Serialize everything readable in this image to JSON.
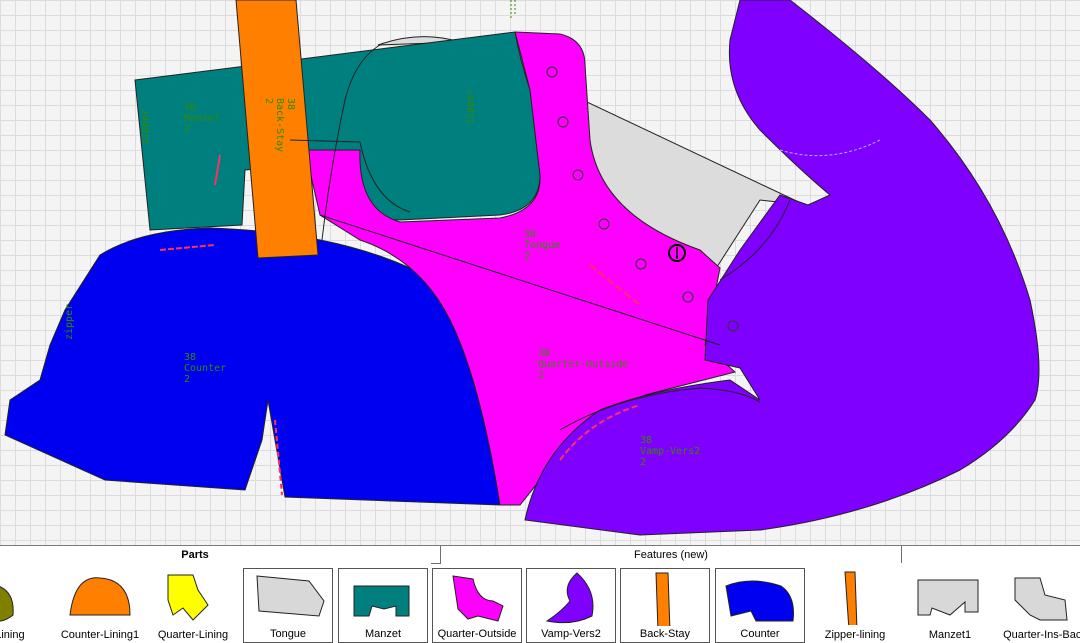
{
  "pieces": {
    "manzet": {
      "size": "38",
      "name": "Manzet",
      "qty": "2"
    },
    "back_stay": {
      "size": "38",
      "name": "Back-Stay",
      "qty": "2"
    },
    "tongue": {
      "size": "38",
      "name": "Tongue",
      "qty": "2"
    },
    "counter": {
      "size": "38",
      "name": "Counter",
      "qty": "2"
    },
    "quarter_outside": {
      "size": "38",
      "name": "Quarter-Outside",
      "qty": "2"
    },
    "vamp": {
      "size": "38",
      "name": "Vamp-Vers2",
      "qty": "2"
    },
    "zipper_label": "zipper"
  },
  "colors": {
    "manzet": "#007f7f",
    "back_stay": "#ff8000",
    "counter": "#0000f0",
    "quarter_outside": "#ff00ff",
    "vamp": "#8000ff",
    "tongue": "#dcdcdc",
    "label": "#2e8b00"
  },
  "panel": {
    "tab_parts": "Parts",
    "tab_features": "Features (new)"
  },
  "thumbnails": [
    {
      "label": "p-Lining",
      "icon": "lining-piece-icon",
      "color": "#808000"
    },
    {
      "label": "Counter-Lining1",
      "icon": "counter-lining-icon",
      "color": "#ff8000"
    },
    {
      "label": "Quarter-Lining",
      "icon": "quarter-lining-icon",
      "color": "#ffff00"
    },
    {
      "label": "Tongue",
      "icon": "tongue-icon",
      "color": "#d8d8d8"
    },
    {
      "label": "Manzet",
      "icon": "manzet-icon",
      "color": "#007f7f"
    },
    {
      "label": "Quarter-Outside",
      "icon": "quarter-outside-icon",
      "color": "#ff00ff"
    },
    {
      "label": "Vamp-Vers2",
      "icon": "vamp-icon",
      "color": "#8000ff"
    },
    {
      "label": "Back-Stay",
      "icon": "back-stay-icon",
      "color": "#ff8000"
    },
    {
      "label": "Counter",
      "icon": "counter-icon",
      "color": "#0000f0"
    },
    {
      "label": "Zipper-lining",
      "icon": "zipper-lining-icon",
      "color": "#ff8000"
    },
    {
      "label": "Manzet1",
      "icon": "manzet1-icon",
      "color": "#d8d8d8"
    },
    {
      "label": "Quarter-Ins-Back",
      "icon": "quarter-ins-back-icon",
      "color": "#d8d8d8"
    }
  ]
}
